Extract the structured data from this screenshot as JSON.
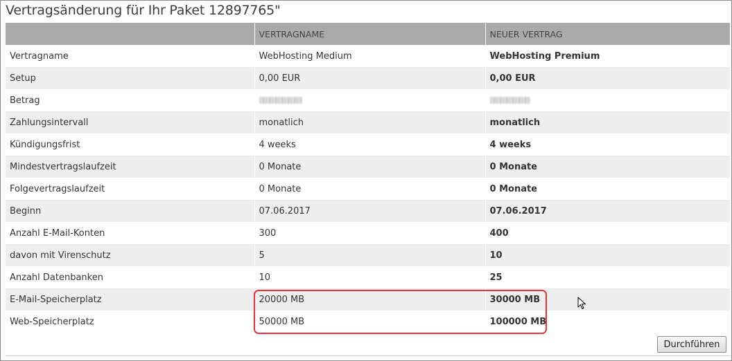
{
  "page": {
    "title": "Vertragsänderung für Ihr Paket 12897765\""
  },
  "table": {
    "headers": [
      "",
      "VERTRAGNAME",
      "NEUER VERTRAG"
    ],
    "rows": [
      {
        "label": "Vertragname",
        "current": "WebHosting Medium",
        "new": "WebHosting Premium"
      },
      {
        "label": "Setup",
        "current": "0,00 EUR",
        "new": "0,00 EUR"
      },
      {
        "label": "Betrag",
        "current": "",
        "new": ""
      },
      {
        "label": "Zahlungsintervall",
        "current": "monatlich",
        "new": "monatlich"
      },
      {
        "label": "Kündigungsfrist",
        "current": "4 weeks",
        "new": "4 weeks"
      },
      {
        "label": "Mindestvertragslaufzeit",
        "current": "0 Monate",
        "new": "0 Monate"
      },
      {
        "label": "Folgevertragslaufzeit",
        "current": "0 Monate",
        "new": "0 Monate"
      },
      {
        "label": "Beginn",
        "current": "07.06.2017",
        "new": "07.06.2017"
      },
      {
        "label": "Anzahl E-Mail-Konten",
        "current": "300",
        "new": "400"
      },
      {
        "label": "davon mit Virenschutz",
        "current": "5",
        "new": "10"
      },
      {
        "label": "Anzahl Datenbanken",
        "current": "10",
        "new": "25"
      },
      {
        "label": "E-Mail-Speicherplatz",
        "current": "20000 MB",
        "new": "30000 MB"
      },
      {
        "label": "Web-Speicherplatz",
        "current": "50000 MB",
        "new": "100000 MB"
      }
    ]
  },
  "actions": {
    "submit_label": "Durchführen"
  },
  "colors": {
    "header_bg": "#aaaaaa",
    "row_alt_bg": "#eeeeee",
    "highlight_border": "#e8323c"
  },
  "icons": {
    "cursor": "mouse-pointer-icon",
    "redacted": "pixelated-redaction"
  }
}
